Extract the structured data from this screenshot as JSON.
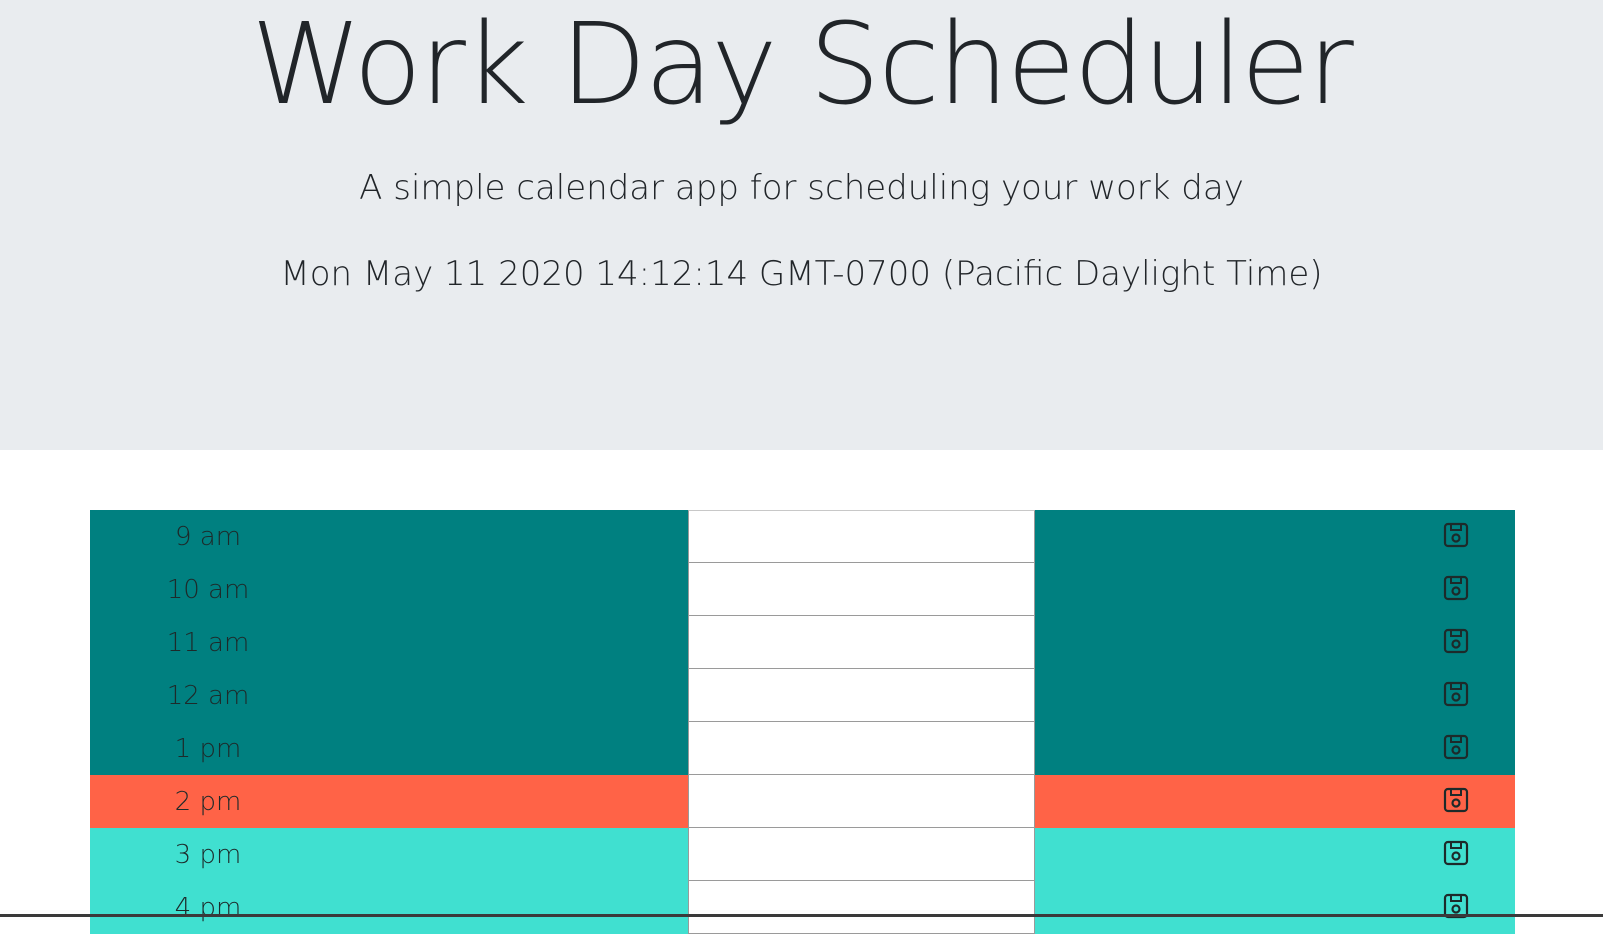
{
  "header": {
    "title": "Work Day Scheduler",
    "lead": "A simple calendar app for scheduling your work day",
    "current_day": "Mon May 11 2020 14:12:14 GMT-0700 (Pacific Daylight Time)"
  },
  "colors": {
    "jumbotron_bg": "#e9ecef",
    "past": "#008080",
    "present": "#ff6347",
    "future": "#40e0d0"
  },
  "time_blocks": [
    {
      "hour": "9 am",
      "status": "past",
      "description": "",
      "icon": "save-icon"
    },
    {
      "hour": "10 am",
      "status": "past",
      "description": "",
      "icon": "save-icon"
    },
    {
      "hour": "11 am",
      "status": "past",
      "description": "",
      "icon": "save-icon"
    },
    {
      "hour": "12 am",
      "status": "past",
      "description": "",
      "icon": "save-icon"
    },
    {
      "hour": "1 pm",
      "status": "past",
      "description": "",
      "icon": "save-icon"
    },
    {
      "hour": "2 pm",
      "status": "present",
      "description": "",
      "icon": "save-icon"
    },
    {
      "hour": "3 pm",
      "status": "future",
      "description": "",
      "icon": "save-icon"
    },
    {
      "hour": "4 pm",
      "status": "future",
      "description": "",
      "icon": "save-icon"
    }
  ]
}
